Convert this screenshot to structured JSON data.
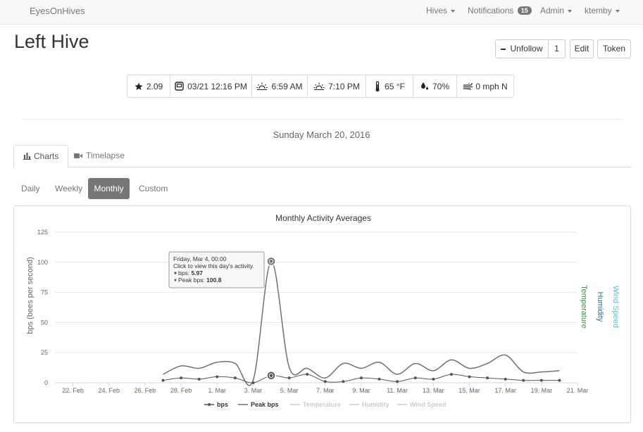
{
  "navbar": {
    "brand": "EyesOnHives",
    "items": [
      {
        "label": "Hives"
      },
      {
        "label": "Notifications",
        "badge": "15"
      },
      {
        "label": "Admin"
      },
      {
        "label": "ktemby"
      }
    ]
  },
  "page": {
    "title": "Left Hive",
    "buttons": {
      "unfollow": "Unfollow",
      "follow_count": "1",
      "edit": "Edit",
      "token": "Token"
    }
  },
  "status": {
    "rating": "2.09",
    "last_update": "03/21 12:16 PM",
    "sunrise": "6:59 AM",
    "sunset": "7:10 PM",
    "temperature": "65 °F",
    "humidity": "70%",
    "wind": "0 mph N"
  },
  "date_heading": "Sunday March 20, 2016",
  "tabs": {
    "charts": "Charts",
    "timelapse": "Timelapse"
  },
  "ranges": {
    "daily": "Daily",
    "weekly": "Weekly",
    "monthly": "Monthly",
    "custom": "Custom",
    "active": "Monthly"
  },
  "tooltip": {
    "title": "Friday, Mar 4, 00:00",
    "hint": "Click to view this day's activity.",
    "bps_label": "bps: ",
    "bps_value": "5.97",
    "peak_label": "Peak bps: ",
    "peak_value": "100.8"
  },
  "colors": {
    "bps": "#555555",
    "peak": "#707070",
    "temperature": "#3a9a3a",
    "humidity": "#2a6fa0",
    "wind": "#5bc0de",
    "active_pill": "#777777"
  },
  "chart_data": {
    "type": "line",
    "title": "Monthly Activity Averages",
    "ylabel": "bps (bees per second)",
    "right_axis_labels": [
      "Temperature",
      "Humidity",
      "Wind Speed"
    ],
    "ylim": [
      0,
      125
    ],
    "yticks": [
      0,
      25,
      50,
      75,
      100,
      125
    ],
    "x_start": "2016-02-21",
    "x_end": "2016-03-21",
    "xticks": [
      "22. Feb",
      "24. Feb",
      "26. Feb",
      "28. Feb",
      "1. Mar",
      "3. Mar",
      "5. Mar",
      "7. Mar",
      "9. Mar",
      "11. Mar",
      "13. Mar",
      "15. Mar",
      "17. Mar",
      "19. Mar",
      "21. Mar"
    ],
    "x": [
      "27 Feb",
      "28 Feb",
      "29 Feb",
      "1 Mar",
      "2 Mar",
      "3 Mar",
      "4 Mar",
      "5 Mar",
      "6 Mar",
      "7 Mar",
      "8 Mar",
      "9 Mar",
      "10 Mar",
      "11 Mar",
      "12 Mar",
      "13 Mar",
      "14 Mar",
      "15 Mar",
      "16 Mar",
      "17 Mar",
      "18 Mar",
      "19 Mar",
      "20 Mar"
    ],
    "series": [
      {
        "name": "bps",
        "values": [
          2,
          4,
          3,
          5,
          4,
          0,
          5.97,
          4,
          7,
          1,
          1,
          4,
          3,
          1,
          4,
          3,
          7,
          5,
          4,
          3,
          2,
          2,
          2
        ]
      },
      {
        "name": "Peak bps",
        "values": [
          7,
          14,
          12,
          17,
          16,
          2,
          100.8,
          13,
          12,
          4,
          16,
          12,
          17,
          7,
          16,
          10,
          19,
          12,
          16,
          23,
          9,
          9,
          10
        ]
      },
      {
        "name": "Temperature",
        "values": []
      },
      {
        "name": "Humidity",
        "values": []
      },
      {
        "name": "Wind Speed",
        "values": []
      }
    ],
    "highlight_index": 6,
    "grid": true,
    "legend": "bottom-center"
  }
}
